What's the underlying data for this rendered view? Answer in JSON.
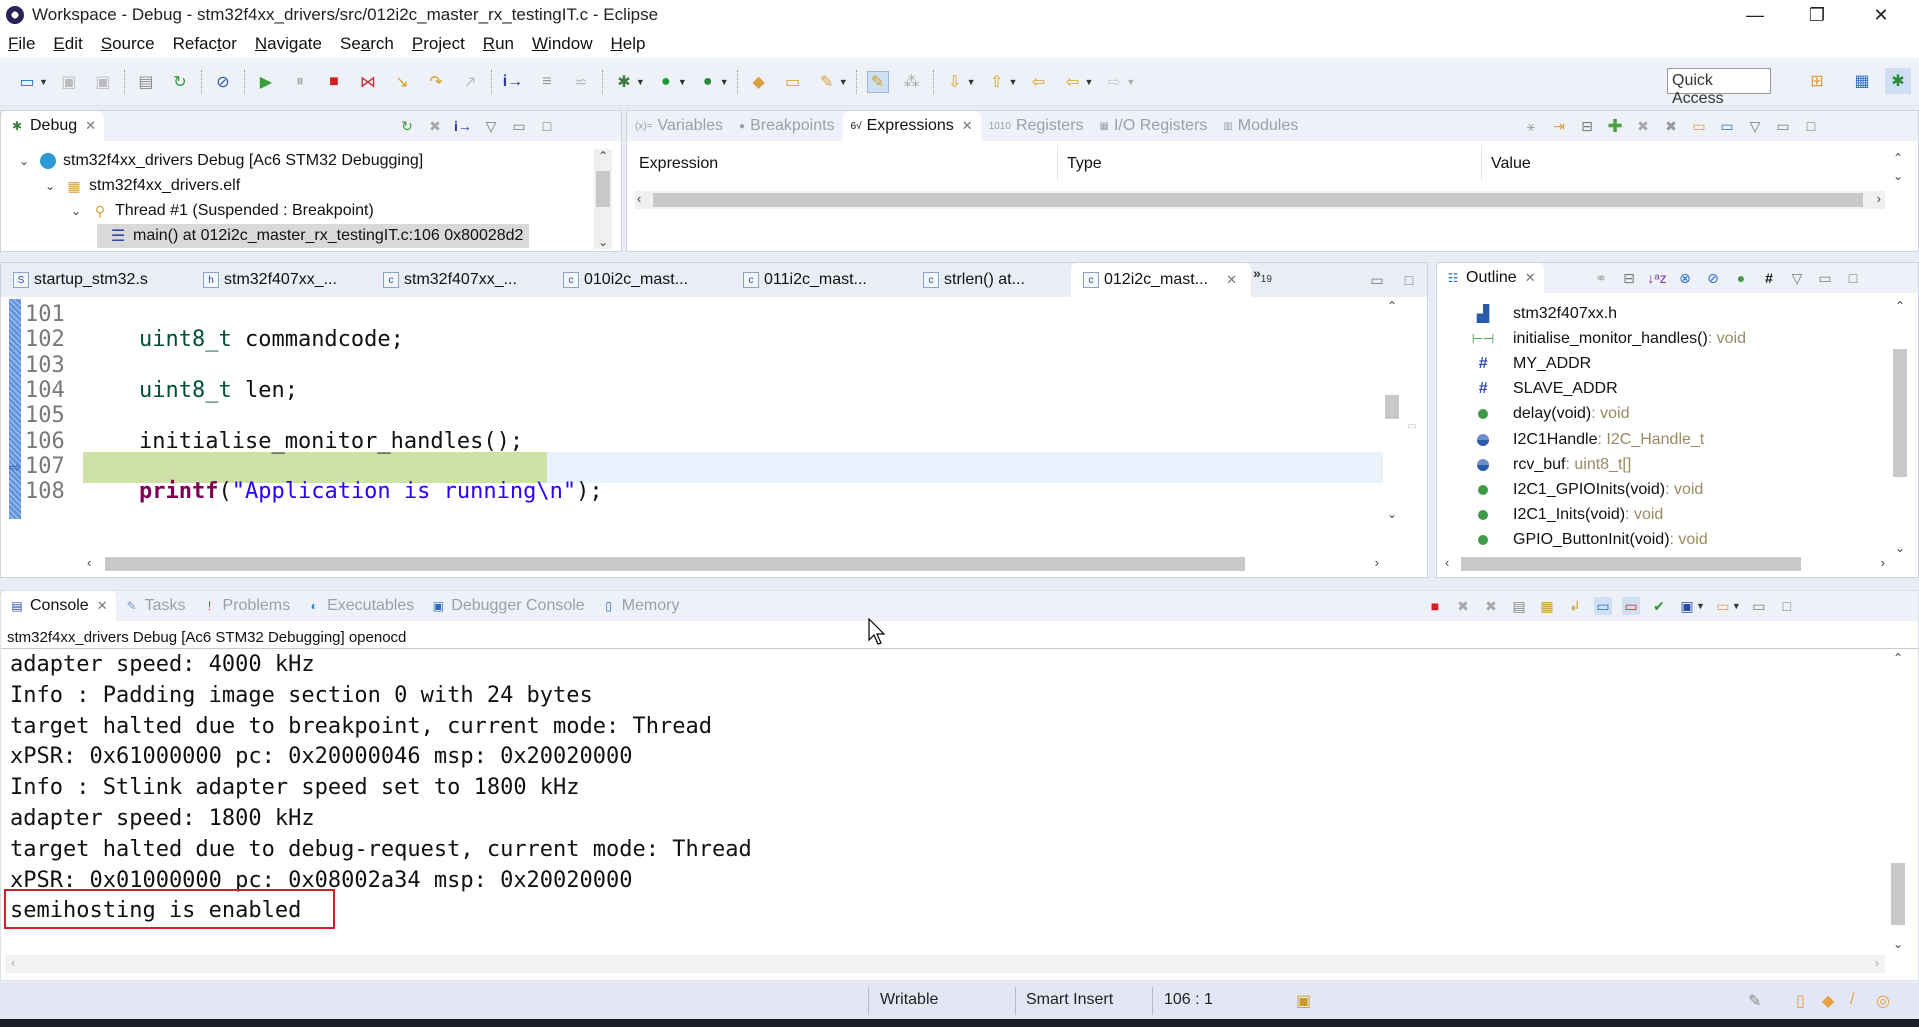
{
  "window": {
    "title": "Workspace - Debug - stm32f4xx_drivers/src/012i2c_master_rx_testingIT.c - Eclipse",
    "controls": {
      "minimize": "—",
      "restore": "❐",
      "close": "✕"
    }
  },
  "menu": [
    {
      "label": "File",
      "mnemonic": "F",
      "rest": "ile"
    },
    {
      "label": "Edit",
      "mnemonic": "E",
      "rest": "dit"
    },
    {
      "label": "Source",
      "mnemonic": "S",
      "rest": "ource"
    },
    {
      "label": "Refactor",
      "pre": "Refac",
      "mnemonic": "t",
      "rest": "or"
    },
    {
      "label": "Navigate",
      "mnemonic": "N",
      "rest": "avigate"
    },
    {
      "label": "Search",
      "pre": "Se",
      "mnemonic": "a",
      "rest": "rch"
    },
    {
      "label": "Project",
      "mnemonic": "P",
      "rest": "roject"
    },
    {
      "label": "Run",
      "mnemonic": "R",
      "rest": "un"
    },
    {
      "label": "Window",
      "mnemonic": "W",
      "rest": "indow"
    },
    {
      "label": "Help",
      "mnemonic": "H",
      "rest": "elp"
    }
  ],
  "toolbar": {
    "quick_access": "Quick Access",
    "icons": [
      "new-icon",
      "save-icon",
      "save-all-icon",
      "binary-icon",
      "relaunch-icon",
      "skip-breakpoints-icon",
      "resume-icon",
      "suspend-icon",
      "terminate-icon",
      "disconnect-icon",
      "step-into-icon",
      "step-over-icon",
      "step-return-icon",
      "instruction-step-icon",
      "use-step-filters-icon",
      "debug-icon",
      "run-icon",
      "external-tools-icon",
      "open-type-icon",
      "open-folder-icon",
      "search-pen-icon",
      "toggle-mark-icon",
      "toggle-breadcrumb-icon",
      "next-annotation-icon",
      "prev-annotation-icon",
      "last-edit-icon",
      "back-icon",
      "forward-icon"
    ]
  },
  "debug_view": {
    "tab_label": "Debug",
    "tree": [
      {
        "label": "stm32f4xx_drivers Debug [Ac6 STM32 Debugging]",
        "icon": "launch-icon",
        "level": 0
      },
      {
        "label": "stm32f4xx_drivers.elf",
        "icon": "process-icon",
        "level": 1
      },
      {
        "label": "Thread #1 (Suspended : Breakpoint)",
        "icon": "thread-icon",
        "level": 2
      },
      {
        "label": "main() at 012i2c_master_rx_testingIT.c:106 0x80028d2",
        "icon": "stack-frame-icon",
        "level": 3,
        "selected": true
      }
    ]
  },
  "expressions_view": {
    "tabs": [
      {
        "label": "Variables",
        "icon": "(x)="
      },
      {
        "label": "Breakpoints",
        "icon": "●"
      },
      {
        "label": "Expressions",
        "icon": "6√",
        "active": true
      },
      {
        "label": "Registers",
        "icon": "1010"
      },
      {
        "label": "I/O Registers",
        "icon": "▦"
      },
      {
        "label": "Modules",
        "icon": "▥"
      }
    ],
    "columns": [
      "Expression",
      "Type",
      "Value"
    ]
  },
  "editor": {
    "tabs": [
      {
        "label": "startup_stm32.s",
        "icon": "S"
      },
      {
        "label": "stm32f407xx_...",
        "icon": "h"
      },
      {
        "label": "stm32f407xx_...",
        "icon": "c"
      },
      {
        "label": "010i2c_mast...",
        "icon": "c"
      },
      {
        "label": "011i2c_mast...",
        "icon": "c"
      },
      {
        "label": "strlen() at...",
        "icon": "c"
      },
      {
        "label": "012i2c_mast...",
        "icon": "c",
        "active": true
      }
    ],
    "overflow": {
      "chevron": "»",
      "count": "19"
    },
    "lines": [
      {
        "num": "101",
        "parts": []
      },
      {
        "num": "102",
        "parts": [
          {
            "t": "uint8_t",
            "c": "kw-type"
          },
          {
            "t": " commandcode;",
            "c": ""
          }
        ]
      },
      {
        "num": "103",
        "parts": []
      },
      {
        "num": "104",
        "parts": [
          {
            "t": "uint8_t",
            "c": "kw-type"
          },
          {
            "t": " len;",
            "c": ""
          }
        ]
      },
      {
        "num": "105",
        "parts": []
      },
      {
        "num": "106",
        "parts": [
          {
            "t": "initialise_monitor_handles();",
            "c": ""
          }
        ],
        "current": true
      },
      {
        "num": "107",
        "parts": []
      },
      {
        "num": "108",
        "parts": [
          {
            "t": "printf",
            "c": "fn"
          },
          {
            "t": "(",
            "c": ""
          },
          {
            "t": "\"Application is running\\n\"",
            "c": "str"
          },
          {
            "t": ");",
            "c": ""
          }
        ]
      }
    ]
  },
  "outline_view": {
    "tab_label": "Outline",
    "items": [
      {
        "name": "stm32f407xx.h",
        "type": "",
        "icon": "include-icon"
      },
      {
        "name": "initialise_monitor_handles()",
        "type": " : void",
        "icon": "function-decl-icon"
      },
      {
        "name": "MY_ADDR",
        "type": "",
        "icon": "macro-icon"
      },
      {
        "name": "SLAVE_ADDR",
        "type": "",
        "icon": "macro-icon"
      },
      {
        "name": "delay(void)",
        "type": " : void",
        "icon": "function-icon"
      },
      {
        "name": "I2C1Handle",
        "type": " : I2C_Handle_t",
        "icon": "variable-icon"
      },
      {
        "name": "rcv_buf",
        "type": " : uint8_t[]",
        "icon": "variable-icon"
      },
      {
        "name": "I2C1_GPIOInits(void)",
        "type": " : void",
        "icon": "function-icon"
      },
      {
        "name": "I2C1_Inits(void)",
        "type": " : void",
        "icon": "function-icon"
      },
      {
        "name": "GPIO_ButtonInit(void)",
        "type": " : void",
        "icon": "function-icon"
      }
    ]
  },
  "console_view": {
    "tabs": [
      {
        "label": "Console",
        "icon": "▤",
        "active": true
      },
      {
        "label": "Tasks",
        "icon": "✎"
      },
      {
        "label": "Problems",
        "icon": "!"
      },
      {
        "label": "Executables",
        "icon": "◐"
      },
      {
        "label": "Debugger Console",
        "icon": "▣"
      },
      {
        "label": "Memory",
        "icon": "▯"
      }
    ],
    "process_label": "stm32f4xx_drivers Debug [Ac6 STM32 Debugging] openocd",
    "lines": [
      "adapter speed: 4000 kHz",
      "Info : Padding image section 0 with 24 bytes",
      "target halted due to breakpoint, current mode: Thread",
      "xPSR: 0x61000000 pc: 0x20000046 msp: 0x20020000",
      "Info : Stlink adapter speed set to 1800 kHz",
      "adapter speed: 1800 kHz",
      "target halted due to debug-request, current mode: Thread",
      "xPSR: 0x01000000 pc: 0x08002a34 msp: 0x20020000",
      "semihosting is enabled"
    ],
    "highlighted_line_index": 8
  },
  "status_bar": {
    "writable": "Writable",
    "insert_mode": "Smart Insert",
    "position": "106 : 1"
  },
  "colors": {
    "current_line": "#cfe0a8",
    "highlight_box": "#d0202a",
    "keyword": "#005032",
    "string": "#2a00ff",
    "function": "#7f0055"
  }
}
